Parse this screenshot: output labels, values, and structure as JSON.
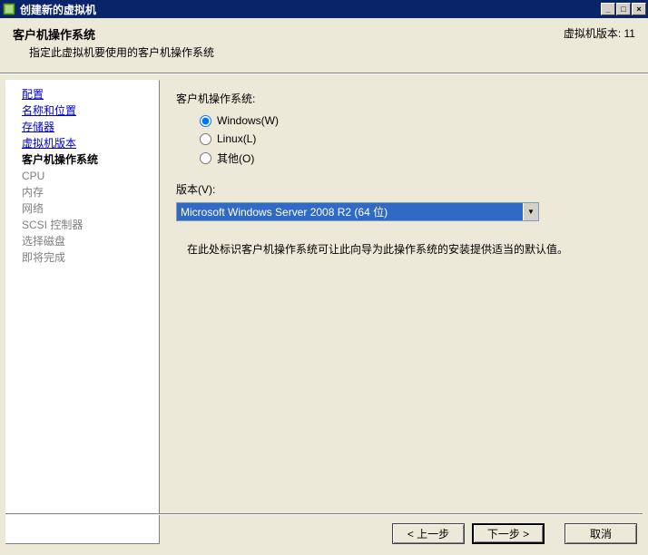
{
  "window": {
    "title": "创建新的虚拟机"
  },
  "header": {
    "title": "客户机操作系统",
    "subtitle": "指定此虚拟机要使用的客户机操作系统",
    "version_label": "虚拟机版本: 11"
  },
  "sidebar": {
    "items": [
      {
        "label": "配置",
        "state": "link"
      },
      {
        "label": "名称和位置",
        "state": "link"
      },
      {
        "label": "存储器",
        "state": "link"
      },
      {
        "label": "虚拟机版本",
        "state": "link"
      },
      {
        "label": "客户机操作系统",
        "state": "current"
      },
      {
        "label": "CPU",
        "state": "disabled"
      },
      {
        "label": "内存",
        "state": "disabled"
      },
      {
        "label": "网络",
        "state": "disabled"
      },
      {
        "label": "SCSI 控制器",
        "state": "disabled"
      },
      {
        "label": "选择磁盘",
        "state": "disabled"
      },
      {
        "label": "即将完成",
        "state": "disabled"
      }
    ]
  },
  "main": {
    "os_group_label": "客户机操作系统:",
    "radios": {
      "windows": "Windows(W)",
      "linux": "Linux(L)",
      "other": "其他(O)"
    },
    "version_label": "版本(V):",
    "version_selected": "Microsoft Windows Server 2008 R2 (64 位)",
    "hint": "在此处标识客户机操作系统可让此向导为此操作系统的安装提供适当的默认值。"
  },
  "buttons": {
    "back": "< 上一步",
    "next": "下一步 >",
    "cancel": "取消"
  }
}
